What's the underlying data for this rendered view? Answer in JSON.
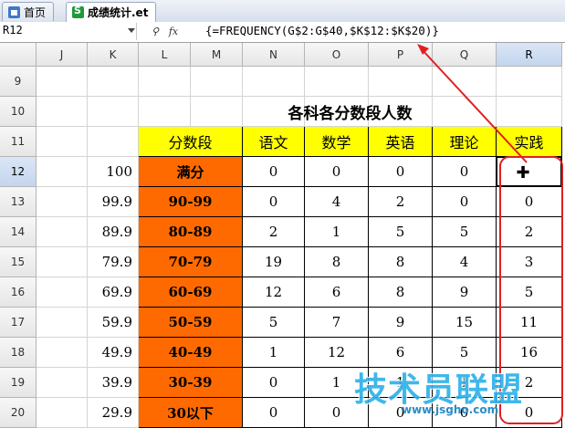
{
  "tabs": [
    {
      "label": "首页",
      "icon": "home-icon",
      "active": false
    },
    {
      "label": "成绩统计.et",
      "icon": "spreadsheet-file-icon",
      "active": true
    }
  ],
  "formula_bar": {
    "name_box": "R12",
    "formula": "{=FREQUENCY(G$2:G$40,$K$12:$K$20)}",
    "fx_label": "fx"
  },
  "columns": [
    "J",
    "K",
    "L",
    "M",
    "N",
    "O",
    "P",
    "Q",
    "R"
  ],
  "rows": [
    "9",
    "10",
    "11",
    "12",
    "13",
    "14",
    "15",
    "16",
    "17",
    "18",
    "19",
    "20"
  ],
  "table": {
    "title": "各科各分数段人数",
    "header": [
      "分数段",
      "语文",
      "数学",
      "英语",
      "理论",
      "实践"
    ],
    "data": [
      {
        "k": "100",
        "range": "满分",
        "vals": [
          "0",
          "0",
          "0",
          "0",
          ""
        ]
      },
      {
        "k": "99.9",
        "range": "90-99",
        "vals": [
          "0",
          "4",
          "2",
          "0",
          "0"
        ]
      },
      {
        "k": "89.9",
        "range": "80-89",
        "vals": [
          "2",
          "1",
          "5",
          "5",
          "2"
        ]
      },
      {
        "k": "79.9",
        "range": "70-79",
        "vals": [
          "19",
          "8",
          "8",
          "4",
          "3"
        ]
      },
      {
        "k": "69.9",
        "range": "60-69",
        "vals": [
          "12",
          "6",
          "8",
          "9",
          "5"
        ]
      },
      {
        "k": "59.9",
        "range": "50-59",
        "vals": [
          "5",
          "7",
          "9",
          "15",
          "11"
        ]
      },
      {
        "k": "49.9",
        "range": "40-49",
        "vals": [
          "1",
          "12",
          "6",
          "5",
          "16"
        ]
      },
      {
        "k": "39.9",
        "range": "30-39",
        "vals": [
          "0",
          "1",
          "1",
          "1",
          "2"
        ]
      },
      {
        "k": "29.9",
        "range": "30以下",
        "vals": [
          "0",
          "0",
          "0",
          "0",
          "0"
        ]
      }
    ]
  },
  "watermark": {
    "text": "技术员联盟",
    "url": "www.jsgho.com"
  },
  "colors": {
    "orange": "#ff6a00",
    "yellow": "#ffff00",
    "annotation": "#e02020"
  }
}
